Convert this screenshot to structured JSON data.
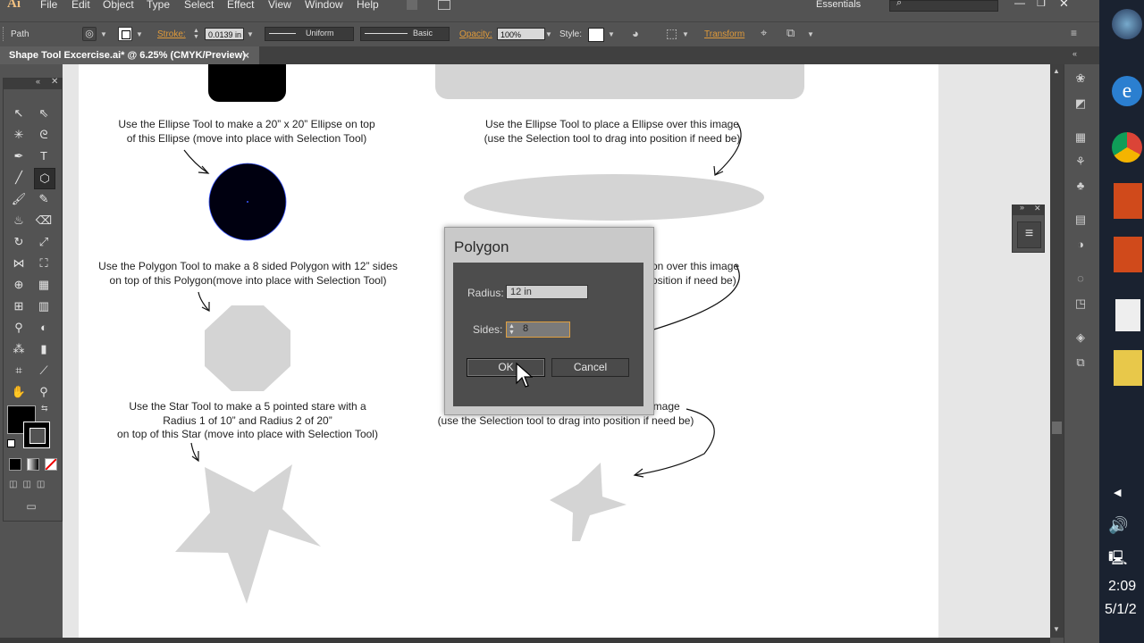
{
  "app": {
    "logo": "Ai"
  },
  "menu": [
    "File",
    "Edit",
    "Object",
    "Type",
    "Select",
    "Effect",
    "View",
    "Window",
    "Help"
  ],
  "workspace": "Essentials",
  "control_bar": {
    "selection": "Path",
    "stroke_label": "Stroke:",
    "stroke_value": "0.0139 in",
    "profile": "Uniform",
    "brush": "Basic",
    "opacity_label": "Opacity:",
    "opacity_value": "100%",
    "style_label": "Style:",
    "transform_label": "Transform"
  },
  "document_tab": {
    "title": "Shape Tool Excercise.ai* @ 6.25% (CMYK/Preview)",
    "close": "×"
  },
  "captions": {
    "ellipse_left": [
      "Use the Ellipse Tool to make a  20” x 20” Ellipse on top",
      "of this Ellipse (move into place with Selection Tool)"
    ],
    "ellipse_right": [
      "Use the Ellipse Tool to place a Ellipse over this image",
      "(use the Selection tool to drag into position if need be)"
    ],
    "polygon_left": [
      "Use the Polygon Tool to make a  8 sided Polygon with 12” sides",
      "on top of this Polygon(move into place with Selection Tool)"
    ],
    "polygon_right": [
      "on over this image",
      "osition if need be)"
    ],
    "star_left": [
      "Use the Star Tool to make a  5 pointed stare with a",
      "Radius 1 of 10” and Radius 2 of 20”",
      "on top of this Star (move into place with Selection Tool)"
    ],
    "star_right": [
      "image",
      "(use the Selection tool to drag into position if need be)"
    ]
  },
  "dialog": {
    "title": "Polygon",
    "radius_label": "Radius:",
    "radius_value": "12 in",
    "sides_label": "Sides:",
    "sides_value": "8",
    "ok_label": "OK",
    "cancel_label": "Cancel"
  },
  "taskbar": {
    "time": "2:09",
    "date": "5/1/2"
  },
  "colors": {
    "fill": "#000000",
    "shape_gray": "#d4d4d4",
    "ellipse_fill": "#000010",
    "accent_orange": "#e09a3a"
  }
}
